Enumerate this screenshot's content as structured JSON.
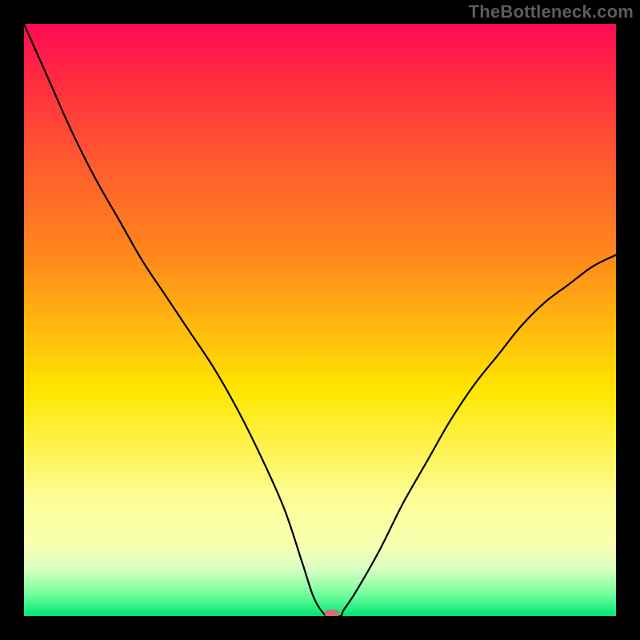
{
  "attribution": "TheBottleneck.com",
  "chart_data": {
    "type": "line",
    "title": "",
    "xlabel": "",
    "ylabel": "",
    "xlim": [
      0,
      100
    ],
    "ylim": [
      0,
      100
    ],
    "grid": false,
    "legend": false,
    "curve_note": "V-shaped curve. Left branch descends from top-left to minimum near x≈52; right branch rises smoothly toward upper-right. Minimum marked with a small red pill marker on the baseline.",
    "x": [
      0,
      4,
      8,
      12,
      16,
      20,
      24,
      28,
      32,
      36,
      40,
      44,
      47,
      49,
      51,
      52,
      53.5,
      54,
      56,
      60,
      64,
      68,
      72,
      76,
      80,
      84,
      88,
      92,
      96,
      100
    ],
    "y": [
      100,
      91,
      82,
      74,
      67,
      60,
      54,
      48,
      42,
      35,
      27,
      18,
      9,
      3,
      0,
      0,
      0,
      1,
      4,
      11,
      19,
      26,
      33,
      39,
      44,
      49,
      53,
      56,
      59,
      61
    ],
    "marker": {
      "x": 52,
      "y": 0
    }
  },
  "colors": {
    "curve": "#000000",
    "marker": "#d07272",
    "gradient_top": "#ff0a54",
    "gradient_mid": "#ffe600",
    "gradient_bottom": "#00e676",
    "background": "#000000"
  }
}
